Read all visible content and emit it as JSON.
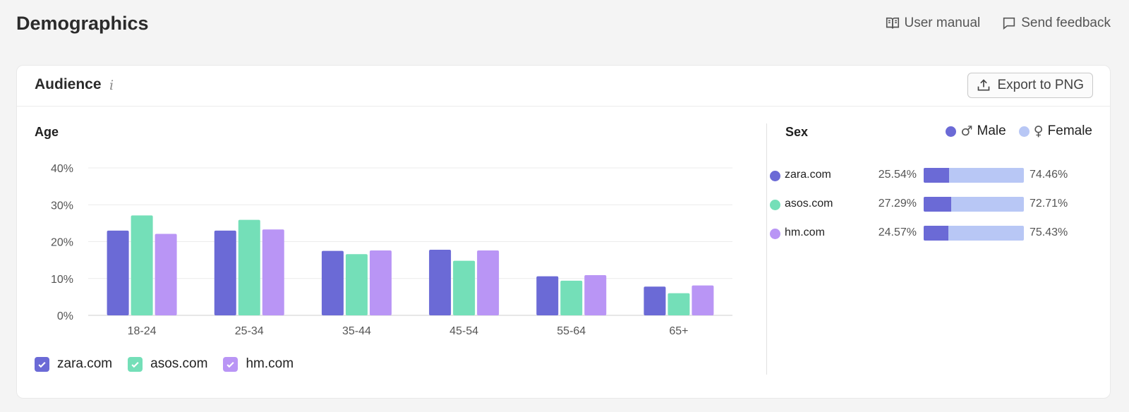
{
  "page": {
    "title": "Demographics",
    "user_manual": "User manual",
    "send_feedback": "Send feedback"
  },
  "card": {
    "title": "Audience",
    "info_icon": "i",
    "export_label": "Export to PNG"
  },
  "colors": {
    "zara": "#6b6ad6",
    "asos": "#74dfb8",
    "hm": "#b995f5",
    "male": "#6b6ad6",
    "female": "#b8c7f5"
  },
  "chart_data": [
    {
      "type": "bar",
      "title": "Age",
      "categories": [
        "18-24",
        "25-34",
        "35-44",
        "45-54",
        "55-64",
        "65+"
      ],
      "series": [
        {
          "name": "zara.com",
          "values": [
            23.0,
            23.0,
            17.5,
            17.8,
            10.6,
            7.8
          ]
        },
        {
          "name": "asos.com",
          "values": [
            27.1,
            25.9,
            16.6,
            14.8,
            9.4,
            6.0
          ]
        },
        {
          "name": "hm.com",
          "values": [
            22.1,
            23.3,
            17.6,
            17.6,
            10.9,
            8.1
          ]
        }
      ],
      "ylim": [
        0,
        40
      ],
      "yticks": [
        "0%",
        "10%",
        "20%",
        "30%",
        "40%"
      ],
      "grid": true,
      "legend": "bottom-left"
    },
    {
      "type": "bar",
      "stacked": true,
      "orientation": "horizontal",
      "title": "Sex",
      "legend_labels": {
        "male": "Male",
        "female": "Female"
      },
      "rows": [
        {
          "site": "zara.com",
          "male": 25.54,
          "female": 74.46,
          "male_label": "25.54%",
          "female_label": "74.46%"
        },
        {
          "site": "asos.com",
          "male": 27.29,
          "female": 72.71,
          "male_label": "27.29%",
          "female_label": "72.71%"
        },
        {
          "site": "hm.com",
          "male": 24.57,
          "female": 75.43,
          "male_label": "24.57%",
          "female_label": "75.43%"
        }
      ]
    }
  ]
}
